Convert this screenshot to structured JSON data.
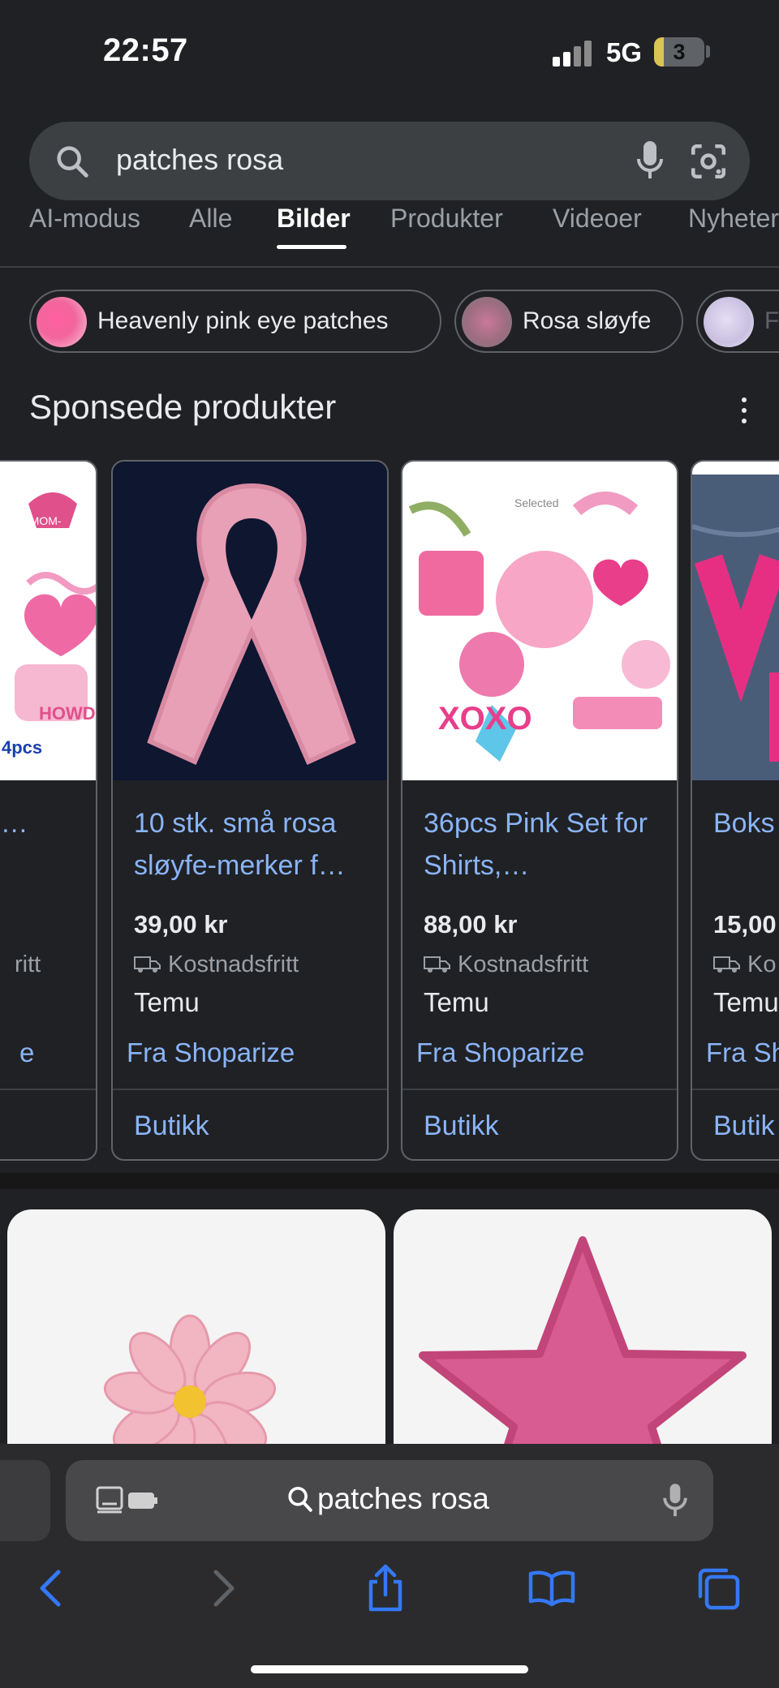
{
  "status_bar": {
    "time": "22:57",
    "network": "5G",
    "battery": "3",
    "battery_level": 0.2
  },
  "search": {
    "query": "patches rosa"
  },
  "tabs": [
    {
      "label": "AI-modus"
    },
    {
      "label": "Alle"
    },
    {
      "label": "Bilder",
      "active": true
    },
    {
      "label": "Produkter"
    },
    {
      "label": "Videoer"
    },
    {
      "label": "Nyheter"
    }
  ],
  "chips": [
    {
      "label": "Heavenly pink eye patches"
    },
    {
      "label": "Rosa sløyfe"
    },
    {
      "label": "F"
    }
  ],
  "sponsored": {
    "title": "Sponsede produkter",
    "products": [
      {
        "title": "Rosa Cowgir…",
        "price": "",
        "shipping": "ritt",
        "store": "",
        "source": "e",
        "shop": "",
        "image_text": "4pcs"
      },
      {
        "title": "10 stk. små rosa sløyfe-merker f…",
        "price": "39,00 kr",
        "shipping": "Kostnadsfritt",
        "store": "Temu",
        "source": "Fra Shoparize",
        "shop": "Butikk"
      },
      {
        "title": "36pcs Pink Set for Shirts,…",
        "price": "88,00 kr",
        "shipping": "Kostnadsfritt",
        "store": "Temu",
        "source": "Fra Shoparize",
        "shop": "Butikk",
        "image_text": "Selected"
      },
      {
        "title": "Boks Patch",
        "price": "15,00",
        "shipping": "Ko",
        "store": "Temu",
        "source": "Fra Sh",
        "shop": "Butik"
      }
    ]
  },
  "safari": {
    "address": "patches rosa"
  },
  "colors": {
    "background": "#202124",
    "link": "#8ab4f8",
    "search_bar": "#3c4043",
    "safari_accent": "#3478f6"
  }
}
